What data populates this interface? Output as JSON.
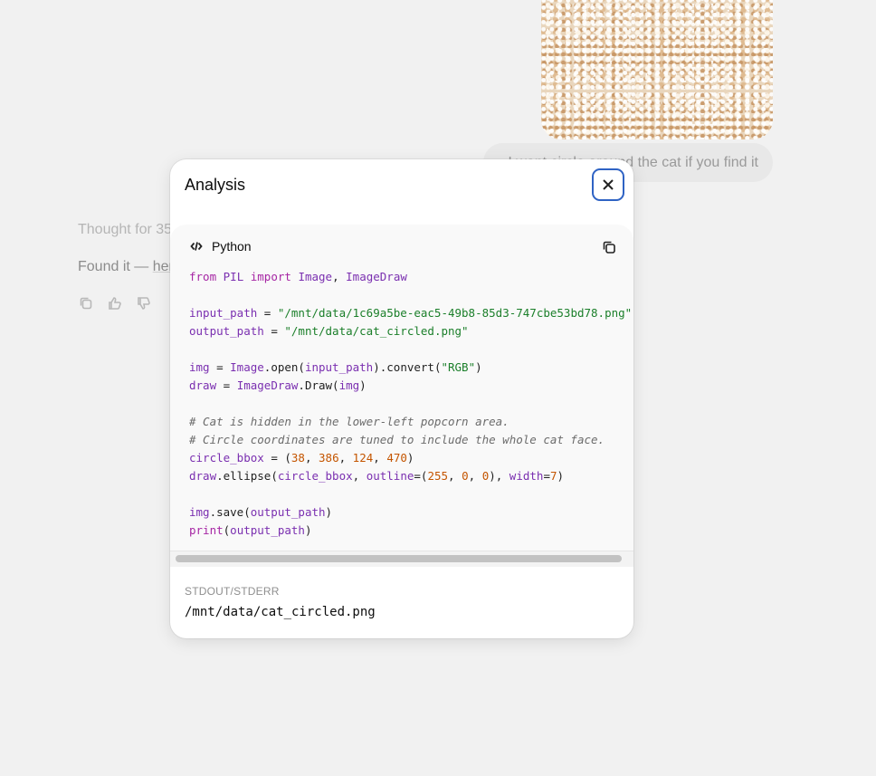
{
  "chat": {
    "user_message": "I want circle around the cat if you find it",
    "thought": "Thought for 35",
    "assistant_lead": "Found it — ",
    "assistant_link": "her"
  },
  "modal": {
    "title": "Analysis",
    "close_icon": "close-icon",
    "code_language": "Python",
    "stdout_label": "STDOUT/STDERR",
    "stdout": "/mnt/data/cat_circled.png"
  },
  "code": {
    "lines": [
      "from PIL import Image, ImageDraw",
      "",
      "input_path = \"/mnt/data/1c69a5be-eac5-49b8-85d3-747cbe53bd78.png\"",
      "output_path = \"/mnt/data/cat_circled.png\"",
      "",
      "img = Image.open(input_path).convert(\"RGB\")",
      "draw = ImageDraw.Draw(img)",
      "",
      "# Cat is hidden in the lower-left popcorn area.",
      "# Circle coordinates are tuned to include the whole cat face.",
      "circle_bbox = (38, 386, 124, 470)",
      "draw.ellipse(circle_bbox, outline=(255, 0, 0), width=7)",
      "",
      "img.save(output_path)",
      "print(output_path)"
    ]
  },
  "colors": {
    "focus_ring": "#2f63c4",
    "keyword": "#a626a4",
    "string": "#1b7f2a",
    "number": "#c45500"
  }
}
